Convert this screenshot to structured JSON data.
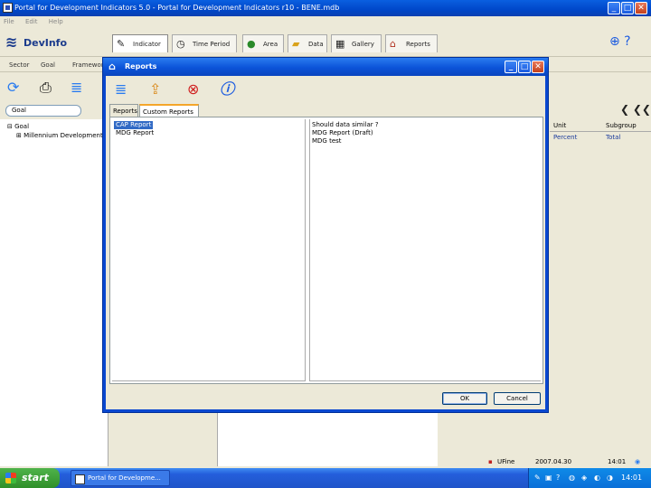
{
  "app": {
    "title": "Portal for Development Indicators 5.0 - Portal for Development Indicators r10 - BENE.mdb",
    "menu": [
      "File",
      "Edit",
      "Help"
    ],
    "logo": "DevInfo",
    "tabs": [
      {
        "label": "Indicator",
        "icon": "pencil-icon"
      },
      {
        "label": "Time Period",
        "icon": "clock-icon"
      },
      {
        "label": "Area",
        "icon": "globe-icon"
      },
      {
        "label": "Data",
        "icon": "folder-icon"
      },
      {
        "label": "Gallery",
        "icon": "gallery-icon"
      },
      {
        "label": "Reports",
        "icon": "home-icon"
      }
    ],
    "subbar": [
      "Sector",
      "Goal",
      "Framework"
    ],
    "search_placeholder": "Goal",
    "tree": [
      "Goal",
      "Millennium Development"
    ],
    "columns": [
      "Unit",
      "Subgroup"
    ],
    "row": [
      "Percent",
      "Total"
    ],
    "status": {
      "source": "UFine",
      "date": "2007.04.30",
      "time": "14:01"
    }
  },
  "dialog": {
    "title": "Reports",
    "tabs": [
      "Reports",
      "Custom Reports"
    ],
    "left_list": [
      "CAP Report",
      "MDG Report"
    ],
    "right_list": [
      "Should data similar ?",
      "MDG Report (Draft)",
      "MDG test"
    ],
    "ok_label": "OK",
    "cancel_label": "Cancel"
  },
  "taskbar": {
    "start_label": "start",
    "task_label": "Portal for Developme...",
    "clock": "14:01"
  },
  "colors": {
    "titlebar": "#0a5fe0",
    "selection": "#316ac5",
    "taskbar": "#245edb"
  }
}
